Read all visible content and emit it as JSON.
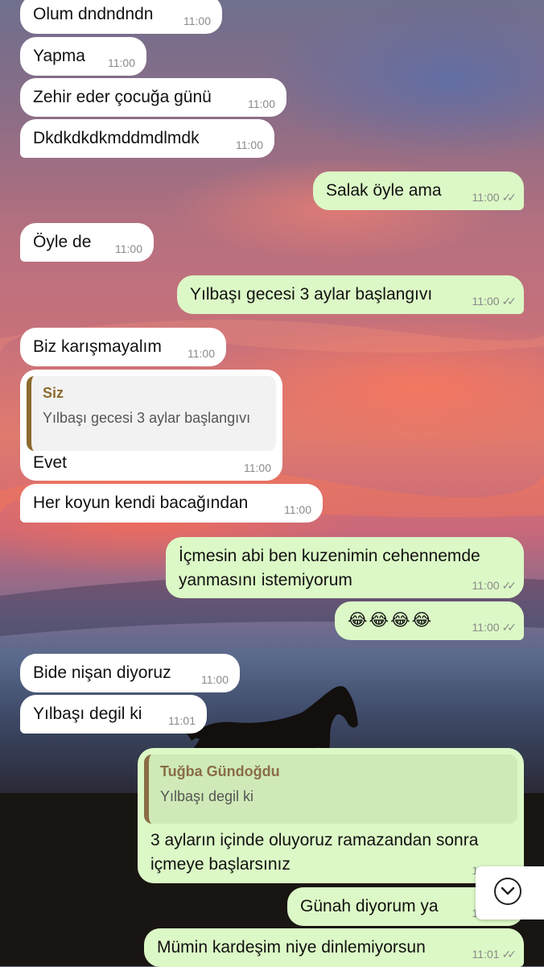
{
  "chat": {
    "messages": [
      {
        "dir": "in",
        "text": "Olum dndndndn",
        "time": "11:00"
      },
      {
        "dir": "in",
        "text": "Yapma",
        "time": "11:00"
      },
      {
        "dir": "in",
        "text": "Zehir eder çocuğa günü",
        "time": "11:00"
      },
      {
        "dir": "in",
        "text": "Dkdkdkdkmddmdlmdk",
        "time": "11:00"
      },
      {
        "dir": "out",
        "text": "Salak öyle ama",
        "time": "11:00"
      },
      {
        "dir": "in",
        "text": "Öyle de",
        "time": "11:00"
      },
      {
        "dir": "out",
        "text": "Yılbaşı gecesi 3 aylar başlangıvı",
        "time": "11:00"
      },
      {
        "dir": "in",
        "text": "Biz karışmayalım",
        "time": "11:00"
      },
      {
        "dir": "in",
        "text": "Evet",
        "time": "11:00",
        "reply": {
          "name": "Siz",
          "text": "Yılbaşı gecesi 3 aylar başlangıvı"
        }
      },
      {
        "dir": "in",
        "text": "Her koyun kendi bacağından",
        "time": "11:00"
      },
      {
        "dir": "out",
        "text_line1": "İçmesin abi ben kuzenimin cehennemde",
        "text_line2": "yanmasını istemiyorum",
        "time": "11:00"
      },
      {
        "dir": "out",
        "text": "😂😂😂😂",
        "time": "11:00"
      },
      {
        "dir": "in",
        "text": "Bide nişan diyoruz",
        "time": "11:00"
      },
      {
        "dir": "in",
        "text": "Yılbaşı degil ki",
        "time": "11:01"
      },
      {
        "dir": "out",
        "text_line1": "3 ayların içinde oluyoruz ramazandan sonra",
        "text_line2": "içmeye başlarsınız",
        "time": "11:01",
        "reply": {
          "name": "Tuğba Gündoğdu",
          "text": "Yılbaşı degil ki"
        }
      },
      {
        "dir": "out",
        "text": "Günah diyorum ya",
        "time": "11:01"
      },
      {
        "dir": "out",
        "text": "Mümin kardeşim niye dinlemiyorsun",
        "time": "11:01"
      }
    ],
    "read_ticks": "✓✓",
    "scroll_down_icon": "chevron-down-circle-icon"
  },
  "colors": {
    "incoming_bubble": "#ffffff",
    "outgoing_bubble": "#dcf8c6",
    "reply_name_incoming": "#8b6a2e",
    "reply_name_outgoing": "#8a6d46",
    "timestamp": "#8a8a8a"
  }
}
